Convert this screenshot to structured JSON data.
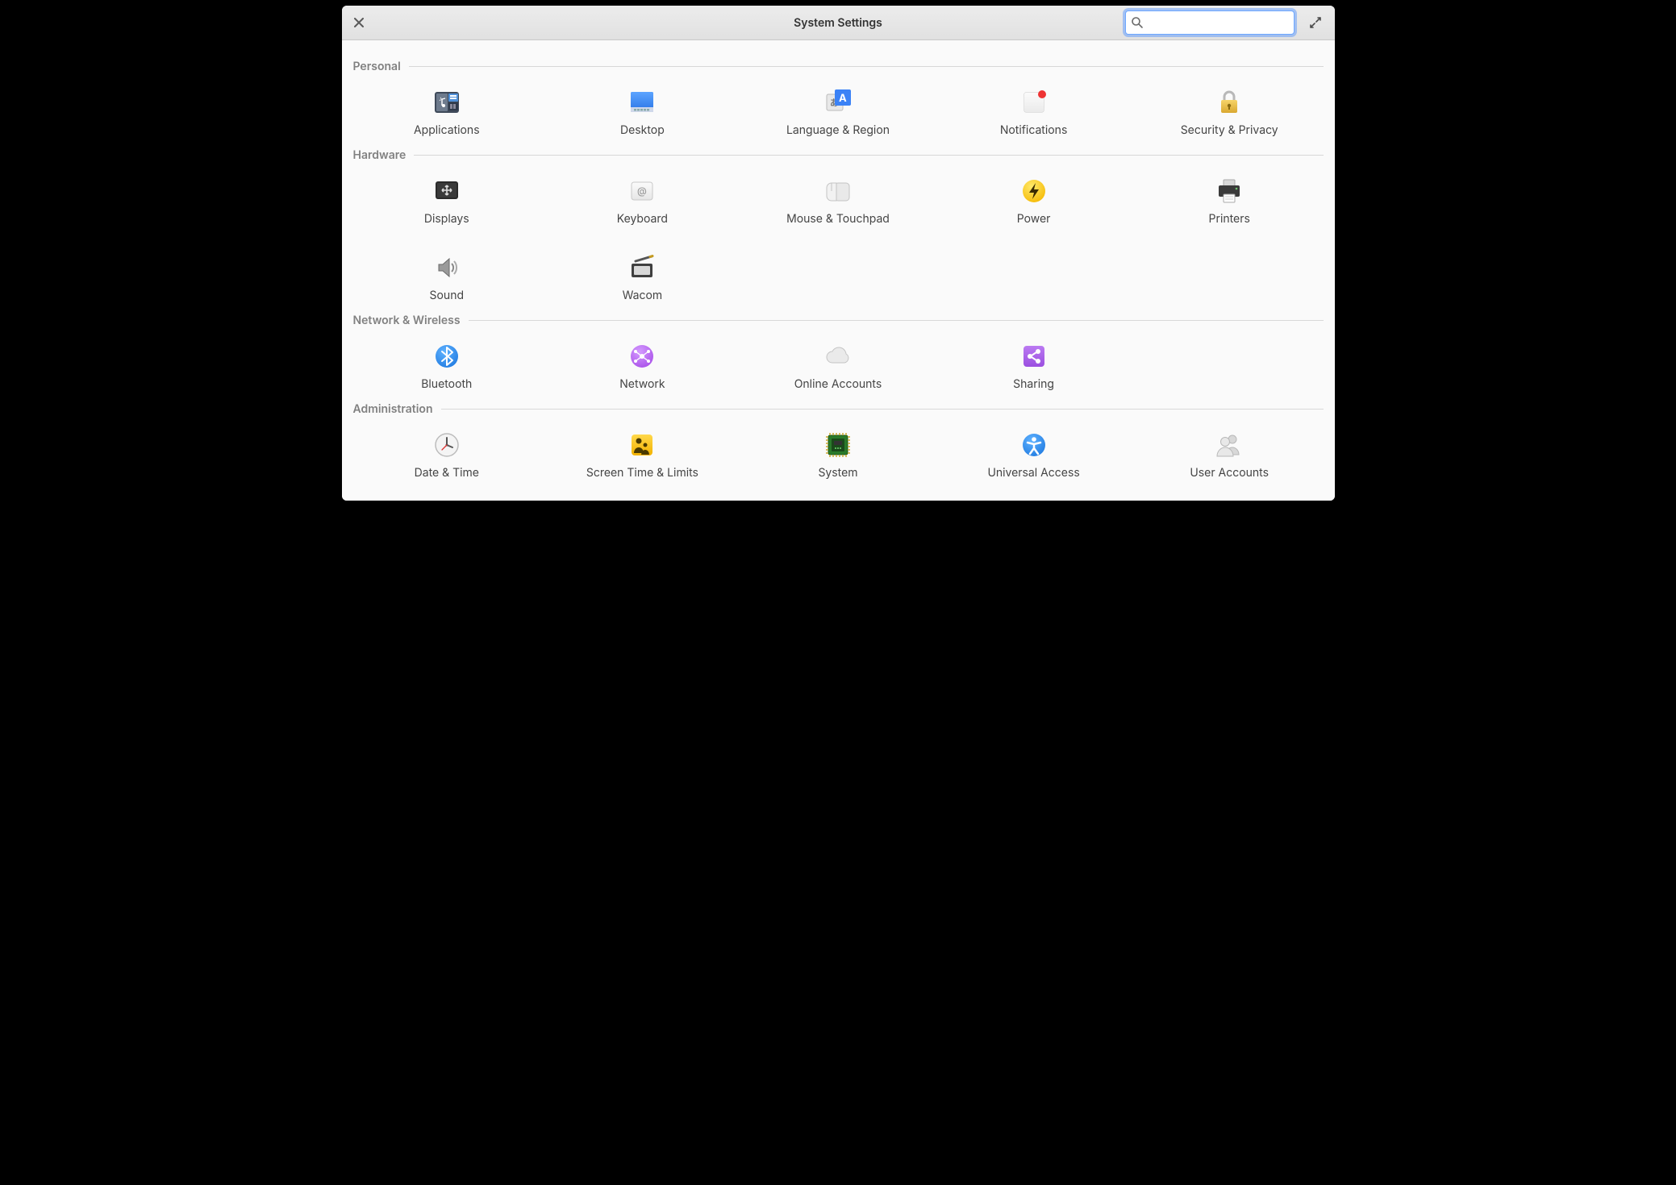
{
  "window": {
    "title": "System Settings"
  },
  "search": {
    "placeholder": ""
  },
  "sections": {
    "personal": {
      "title": "Personal",
      "items": [
        {
          "label": "Applications"
        },
        {
          "label": "Desktop"
        },
        {
          "label": "Language & Region"
        },
        {
          "label": "Notifications"
        },
        {
          "label": "Security & Privacy"
        }
      ]
    },
    "hardware": {
      "title": "Hardware",
      "items": [
        {
          "label": "Displays"
        },
        {
          "label": "Keyboard"
        },
        {
          "label": "Mouse & Touchpad"
        },
        {
          "label": "Power"
        },
        {
          "label": "Printers"
        },
        {
          "label": "Sound"
        },
        {
          "label": "Wacom"
        }
      ]
    },
    "network": {
      "title": "Network & Wireless",
      "items": [
        {
          "label": "Bluetooth"
        },
        {
          "label": "Network"
        },
        {
          "label": "Online Accounts"
        },
        {
          "label": "Sharing"
        }
      ]
    },
    "admin": {
      "title": "Administration",
      "items": [
        {
          "label": "Date & Time"
        },
        {
          "label": "Screen Time & Limits"
        },
        {
          "label": "System"
        },
        {
          "label": "Universal Access"
        },
        {
          "label": "User Accounts"
        }
      ]
    }
  }
}
